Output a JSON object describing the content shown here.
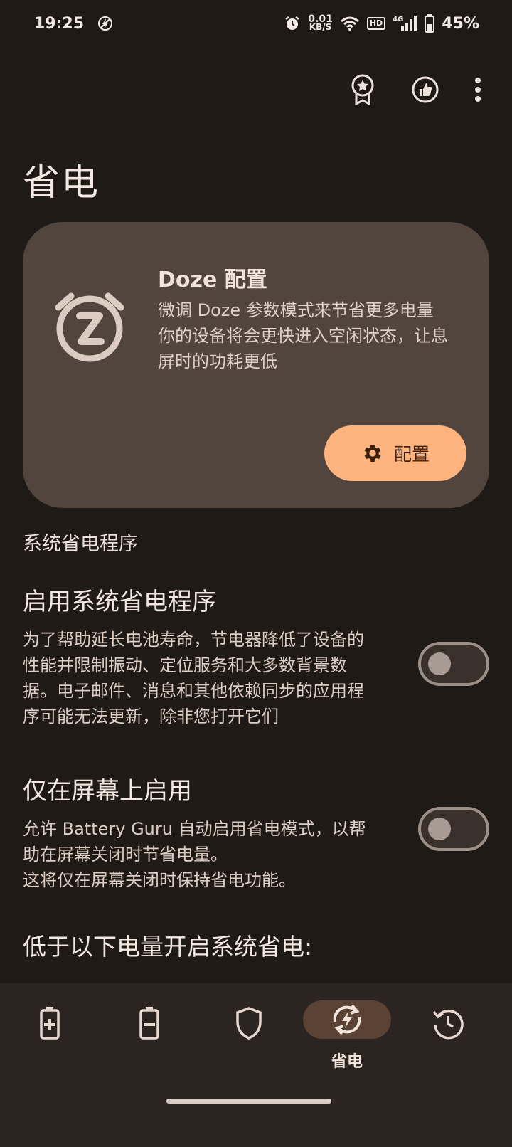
{
  "status_bar": {
    "time": "19:25",
    "net_speed_value": "0.01",
    "net_speed_unit": "KB/S",
    "hd_label": "HD",
    "network_type": "4G",
    "battery_percent": "45%"
  },
  "page": {
    "title": "省电"
  },
  "doze_card": {
    "title": "Doze 配置",
    "description_line1": "微调 Doze 参数模式来节省更多电量",
    "description_line2": "你的设备将会更快进入空闲状态，让息屏时的功耗更低",
    "button_label": "配置"
  },
  "section": {
    "system_saver_header": "系统省电程序"
  },
  "settings": [
    {
      "title": "启用系统省电程序",
      "description": "为了帮助延长电池寿命，节电器降低了设备的性能并限制振动、定位服务和大多数背景数据。电子邮件、消息和其他依赖同步的应用程序可能无法更新，除非您打开它们",
      "enabled": false
    },
    {
      "title": "仅在屏幕上启用",
      "description_line1": "允许 Battery Guru 自动启用省电模式，以帮助在屏幕关闭时节省电量。",
      "description_line2": "这将仅在屏幕关闭时保持省电功能。",
      "enabled": false
    }
  ],
  "below_level": {
    "title": "低于以下电量开启系统省电:"
  },
  "bottom_nav": {
    "active_label": "省电",
    "items": [
      "battery-charging-icon",
      "battery-discharging-icon",
      "shield-icon",
      "power-saving-icon",
      "history-icon"
    ]
  },
  "colors": {
    "background": "#201a17",
    "card": "#52453e",
    "accent": "#fdb37d",
    "nav_background": "#2c2420",
    "nav_active": "#5a4234"
  }
}
